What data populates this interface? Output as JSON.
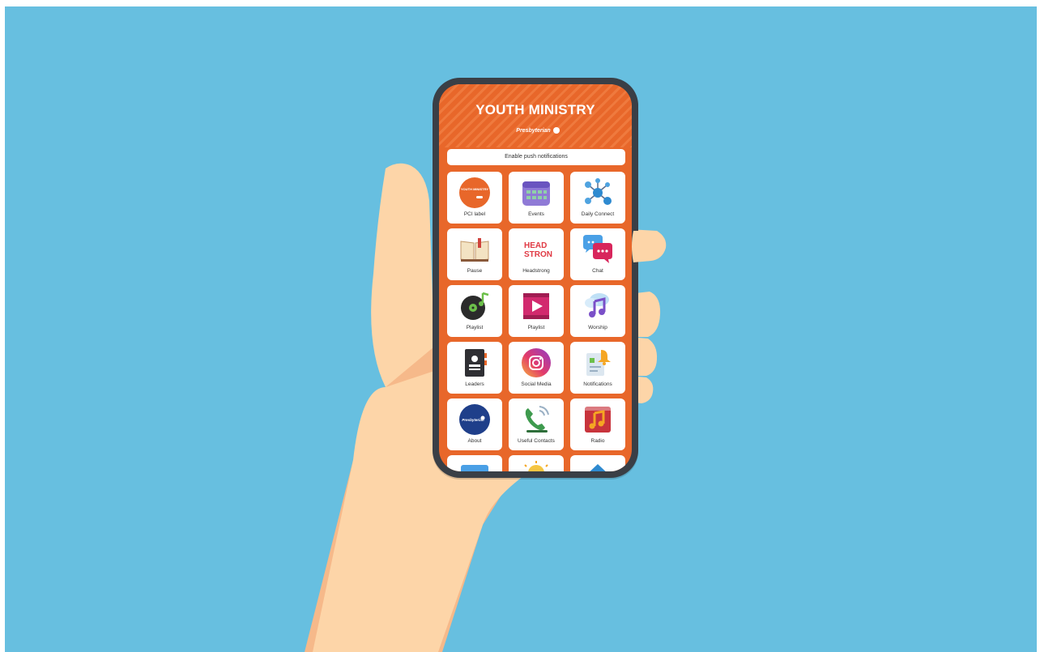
{
  "app": {
    "title": "YOUTH MINISTRY",
    "brand": "Presbyterian"
  },
  "notification_button": "Enable push notifications",
  "tiles": [
    {
      "label": "PCI label",
      "icon": "youth-ministry-logo-icon",
      "badge": "YOUTH MINISTRY"
    },
    {
      "label": "Events",
      "icon": "calendar-icon"
    },
    {
      "label": "Daily Connect",
      "icon": "network-icon"
    },
    {
      "label": "Pause",
      "icon": "open-book-icon"
    },
    {
      "label": "Headstrong",
      "icon": "headstrong-logo-icon",
      "wordmark_top": "HEAD",
      "wordmark_bottom": "STRONG"
    },
    {
      "label": "Chat",
      "icon": "chat-bubbles-icon"
    },
    {
      "label": "Playlist",
      "icon": "music-disc-icon"
    },
    {
      "label": "Playlist",
      "icon": "video-play-icon"
    },
    {
      "label": "Worship",
      "icon": "music-note-cloud-icon"
    },
    {
      "label": "Leaders",
      "icon": "contact-book-icon"
    },
    {
      "label": "Social Media",
      "icon": "instagram-icon"
    },
    {
      "label": "Notifications",
      "icon": "notification-bell-icon"
    },
    {
      "label": "About",
      "icon": "presbyterian-logo-icon",
      "badge": "Presbyterian"
    },
    {
      "label": "Useful Contacts",
      "icon": "phone-contact-icon"
    },
    {
      "label": "Radio",
      "icon": "radio-music-icon"
    },
    {
      "label": "",
      "icon": "photo-icon"
    },
    {
      "label": "",
      "icon": "lightbulb-icon"
    },
    {
      "label": "",
      "icon": "home-icon"
    }
  ],
  "colors": {
    "background": "#67bfe0",
    "accent": "#e8672a",
    "skin": "#fdd5a8",
    "phone_frame": "#3a3f46"
  }
}
